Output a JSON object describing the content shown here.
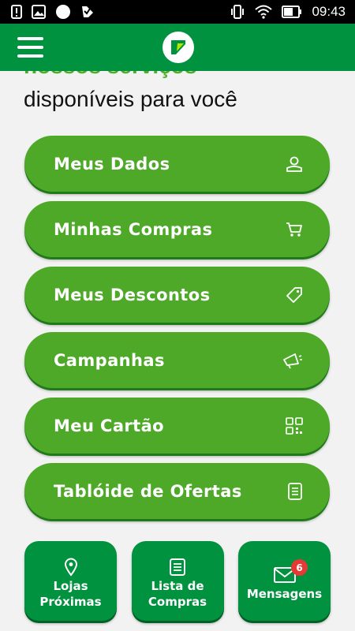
{
  "status_bar": {
    "time": "09:43",
    "left_icons": [
      "alert-icon",
      "image-icon",
      "circle-icon",
      "app-check-icon"
    ],
    "right_icons": [
      "vibrate-icon",
      "wifi-icon",
      "battery-icon"
    ]
  },
  "header": {
    "menu_icon": "hamburger-menu-icon",
    "logo": "app-logo"
  },
  "headline": {
    "line1": "nossos serviços",
    "line2": "disponíveis para você"
  },
  "menu": [
    {
      "label": "Meus Dados",
      "icon": "user-icon"
    },
    {
      "label": "Minhas Compras",
      "icon": "cart-icon"
    },
    {
      "label": "Meus Descontos",
      "icon": "tag-icon"
    },
    {
      "label": "Campanhas",
      "icon": "megaphone-icon"
    },
    {
      "label": "Meu Cartão",
      "icon": "qr-code-icon"
    },
    {
      "label": "Tablóide de Ofertas",
      "icon": "document-icon"
    }
  ],
  "tiles": [
    {
      "label": "Lojas\nPróximas",
      "icon": "location-pin-icon"
    },
    {
      "label": "Lista de\nCompras",
      "icon": "list-icon"
    },
    {
      "label": "Mensagens",
      "icon": "envelope-icon",
      "badge": "6"
    }
  ],
  "colors": {
    "app_bar": "#00923f",
    "button_green": "#4ea929",
    "tile_green": "#00923f",
    "badge_red": "#e53935",
    "background": "#f2f2f2"
  }
}
